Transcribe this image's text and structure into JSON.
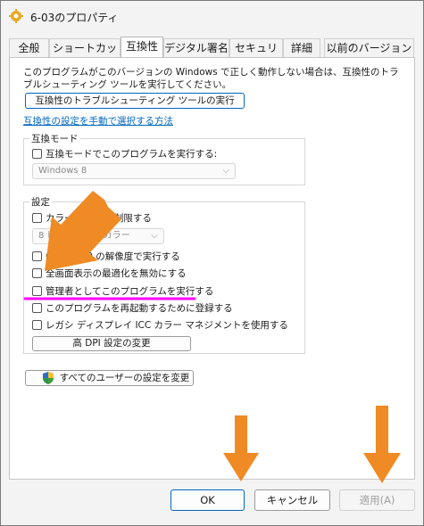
{
  "window": {
    "title": "6-03のプロパティ"
  },
  "tabs": [
    {
      "label": "全般"
    },
    {
      "label": "ショートカット"
    },
    {
      "label": "互換性",
      "active": true
    },
    {
      "label": "デジタル署名"
    },
    {
      "label": "セキュリティ"
    },
    {
      "label": "詳細"
    },
    {
      "label": "以前のバージョン"
    }
  ],
  "intro_text": "このプログラムがこのバージョンの Windows で正しく動作しない場合は、互換性のトラブルシューティング ツールを実行してください。",
  "troubleshoot_button": "互換性のトラブルシューティング ツールの実行",
  "manual_link": "互換性の設定を手動で選択する方法",
  "compat_mode": {
    "group_label": "互換モード",
    "checkbox_label": "互換モードでこのプログラムを実行する:",
    "os_select": "Windows 8"
  },
  "settings": {
    "group_label": "設定",
    "reduced_color": "カラー モードを制限する",
    "color_select": "8 ビット (256) カラー",
    "color_chevron": "⌵",
    "resolution_640": "640 x 480 の解像度で実行する",
    "disable_fullscreen_opt": "全画面表示の最適化を無効にする",
    "run_as_admin": "管理者としてこのプログラムを実行する",
    "register_restart": "このプログラムを再起動するために登録する",
    "legacy_icc": "レガシ ディスプレイ ICC カラー マネジメントを使用する",
    "high_dpi_button": "高 DPI 設定の変更"
  },
  "all_users_button": "すべてのユーザーの設定を変更",
  "footer": {
    "ok": "OK",
    "cancel": "キャンセル",
    "apply": "適用(A)"
  },
  "colors": {
    "accent": "#0067c0",
    "annotation_arrow": "#f08a24",
    "highlight_underline": "#ff00ff"
  }
}
